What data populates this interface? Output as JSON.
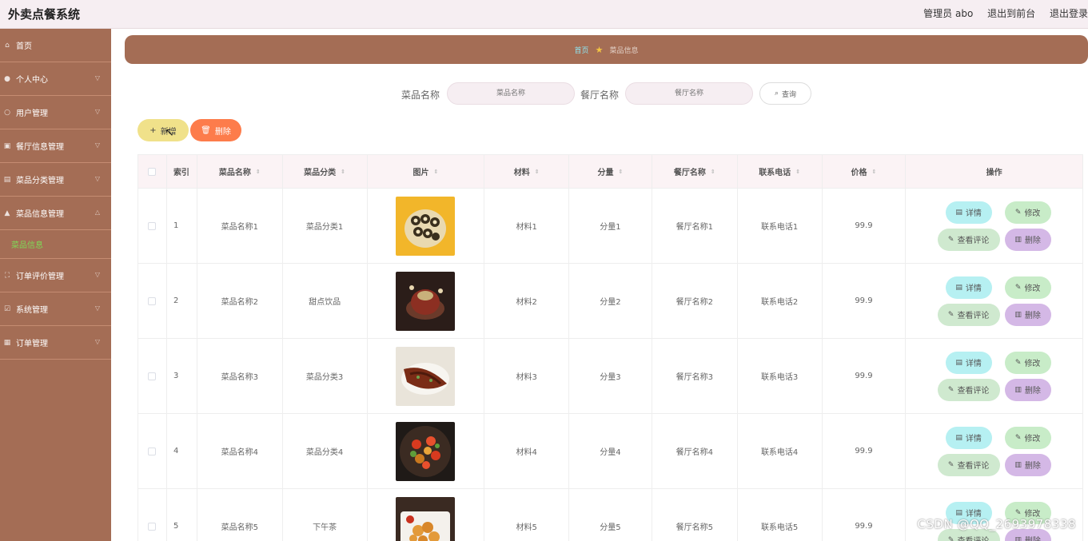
{
  "header": {
    "app_title": "外卖点餐系统",
    "user": "管理员 abo",
    "back_front": "退出到前台",
    "logout": "退出登录"
  },
  "sidebar": {
    "items": [
      {
        "label": "首页",
        "icon": "home-icon",
        "has_children": false
      },
      {
        "label": "个人中心",
        "icon": "user-icon",
        "has_children": true
      },
      {
        "label": "用户管理",
        "icon": "users-icon",
        "has_children": true
      },
      {
        "label": "餐厅信息管理",
        "icon": "restaurant-icon",
        "has_children": true
      },
      {
        "label": "菜品分类管理",
        "icon": "category-icon",
        "has_children": true
      },
      {
        "label": "菜品信息管理",
        "icon": "dish-icon",
        "has_children": true
      },
      {
        "label": "订单评价管理",
        "icon": "review-icon",
        "has_children": true
      },
      {
        "label": "系统管理",
        "icon": "system-icon",
        "has_children": true
      },
      {
        "label": "订单管理",
        "icon": "order-icon",
        "has_children": true
      }
    ],
    "active_sub": "菜品信息"
  },
  "breadcrumb": {
    "home": "首页",
    "current": "菜品信息"
  },
  "search": {
    "dish_label": "菜品名称",
    "dish_placeholder": "菜品名称",
    "restaurant_label": "餐厅名称",
    "restaurant_placeholder": "餐厅名称",
    "button": "查询"
  },
  "actions": {
    "new": "新增",
    "delete": "删除"
  },
  "table": {
    "headers": [
      "索引",
      "菜品名称",
      "菜品分类",
      "图片",
      "材料",
      "分量",
      "餐厅名称",
      "联系电话",
      "价格",
      "操作"
    ],
    "rows": [
      {
        "index": "1",
        "name": "菜品名称1",
        "category": "菜品分类1",
        "material": "材料1",
        "portion": "分量1",
        "restaurant": "餐厅名称1",
        "phone": "联系电话1",
        "price": "99.9",
        "image": "sushi rolls"
      },
      {
        "index": "2",
        "name": "菜品名称2",
        "category": "甜点饮品",
        "material": "材料2",
        "portion": "分量2",
        "restaurant": "餐厅名称2",
        "phone": "联系电话2",
        "price": "99.9",
        "image": "dessert drink"
      },
      {
        "index": "3",
        "name": "菜品名称3",
        "category": "菜品分类3",
        "material": "材料3",
        "portion": "分量3",
        "restaurant": "餐厅名称3",
        "phone": "联系电话3",
        "price": "99.9",
        "image": "braised fish"
      },
      {
        "index": "4",
        "name": "菜品名称4",
        "category": "菜品分类4",
        "material": "材料4",
        "portion": "分量4",
        "restaurant": "餐厅名称4",
        "phone": "联系电话4",
        "price": "99.9",
        "image": "stir-fried chicken"
      },
      {
        "index": "5",
        "name": "菜品名称5",
        "category": "下午茶",
        "material": "材料5",
        "portion": "分量5",
        "restaurant": "餐厅名称5",
        "phone": "联系电话5",
        "price": "99.9",
        "image": "fried snacks"
      }
    ],
    "op_labels": {
      "detail": "详情",
      "edit": "修改",
      "comment": "查看评论",
      "delete": "删除"
    }
  },
  "watermark": "CSDN @QQ_2693978338",
  "colors": {
    "sidebar": "#a46d55",
    "header": "#f6eef2",
    "accent_green": "#7ed957",
    "detail_btn": "#b6f0f2",
    "edit_btn": "#c8ecc8",
    "delete_btn": "#d4b8e6",
    "new_btn": "#f0e18a",
    "batch_delete_btn": "#fd7c4b"
  }
}
